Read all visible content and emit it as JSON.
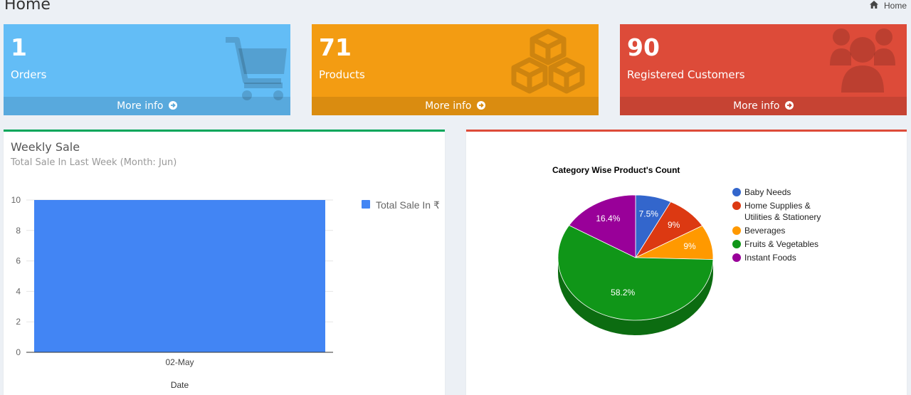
{
  "header": {
    "title": "Home",
    "breadcrumb_label": "Home",
    "breadcrumb_icon": "home-icon"
  },
  "info_boxes": [
    {
      "count": "1",
      "label": "Orders",
      "more_info": "More info",
      "color": "#63bdf6",
      "icon": "shopping-cart-icon"
    },
    {
      "count": "71",
      "label": "Products",
      "more_info": "More info",
      "color": "#f39c12",
      "icon": "cubes-icon"
    },
    {
      "count": "90",
      "label": "Registered Customers",
      "more_info": "More info",
      "color": "#dd4b39",
      "icon": "users-icon"
    }
  ],
  "weekly_sale": {
    "title": "Weekly Sale",
    "subtitle": "Total Sale In Last Week (Month: Jun)"
  },
  "category_chart": {},
  "chart_data": [
    {
      "type": "bar",
      "categories": [
        "02-May"
      ],
      "series": [
        {
          "name": "Total Sale In ₹",
          "values": [
            10
          ],
          "color": "#4285f4"
        }
      ],
      "xlabel": "Date",
      "ylabel": "",
      "ylim": [
        0,
        10
      ],
      "yticks": [
        0,
        2,
        4,
        6,
        8,
        10
      ],
      "grid": true,
      "legend": "right"
    },
    {
      "type": "pie",
      "title": "Category Wise Product's Count",
      "is3d": true,
      "legend": "right",
      "slices": [
        {
          "label": "Baby Needs",
          "legend_lines": [
            "Baby Needs"
          ],
          "percent": 7.5,
          "display": "7.5%",
          "color": "#3366cc"
        },
        {
          "label": "Home Supplies & Utilities & Stationery",
          "legend_lines": [
            "Home Supplies &",
            "Utilities & Stationery"
          ],
          "percent": 9,
          "display": "9%",
          "color": "#dc3912"
        },
        {
          "label": "Beverages",
          "legend_lines": [
            "Beverages"
          ],
          "percent": 9,
          "display": "9%",
          "color": "#ff9900"
        },
        {
          "label": "Fruits & Vegetables",
          "legend_lines": [
            "Fruits & Vegetables"
          ],
          "percent": 58.2,
          "display": "58.2%",
          "color": "#109618"
        },
        {
          "label": "Instant Foods",
          "legend_lines": [
            "Instant Foods"
          ],
          "percent": 16.4,
          "display": "16.4%",
          "color": "#990099"
        }
      ]
    }
  ]
}
